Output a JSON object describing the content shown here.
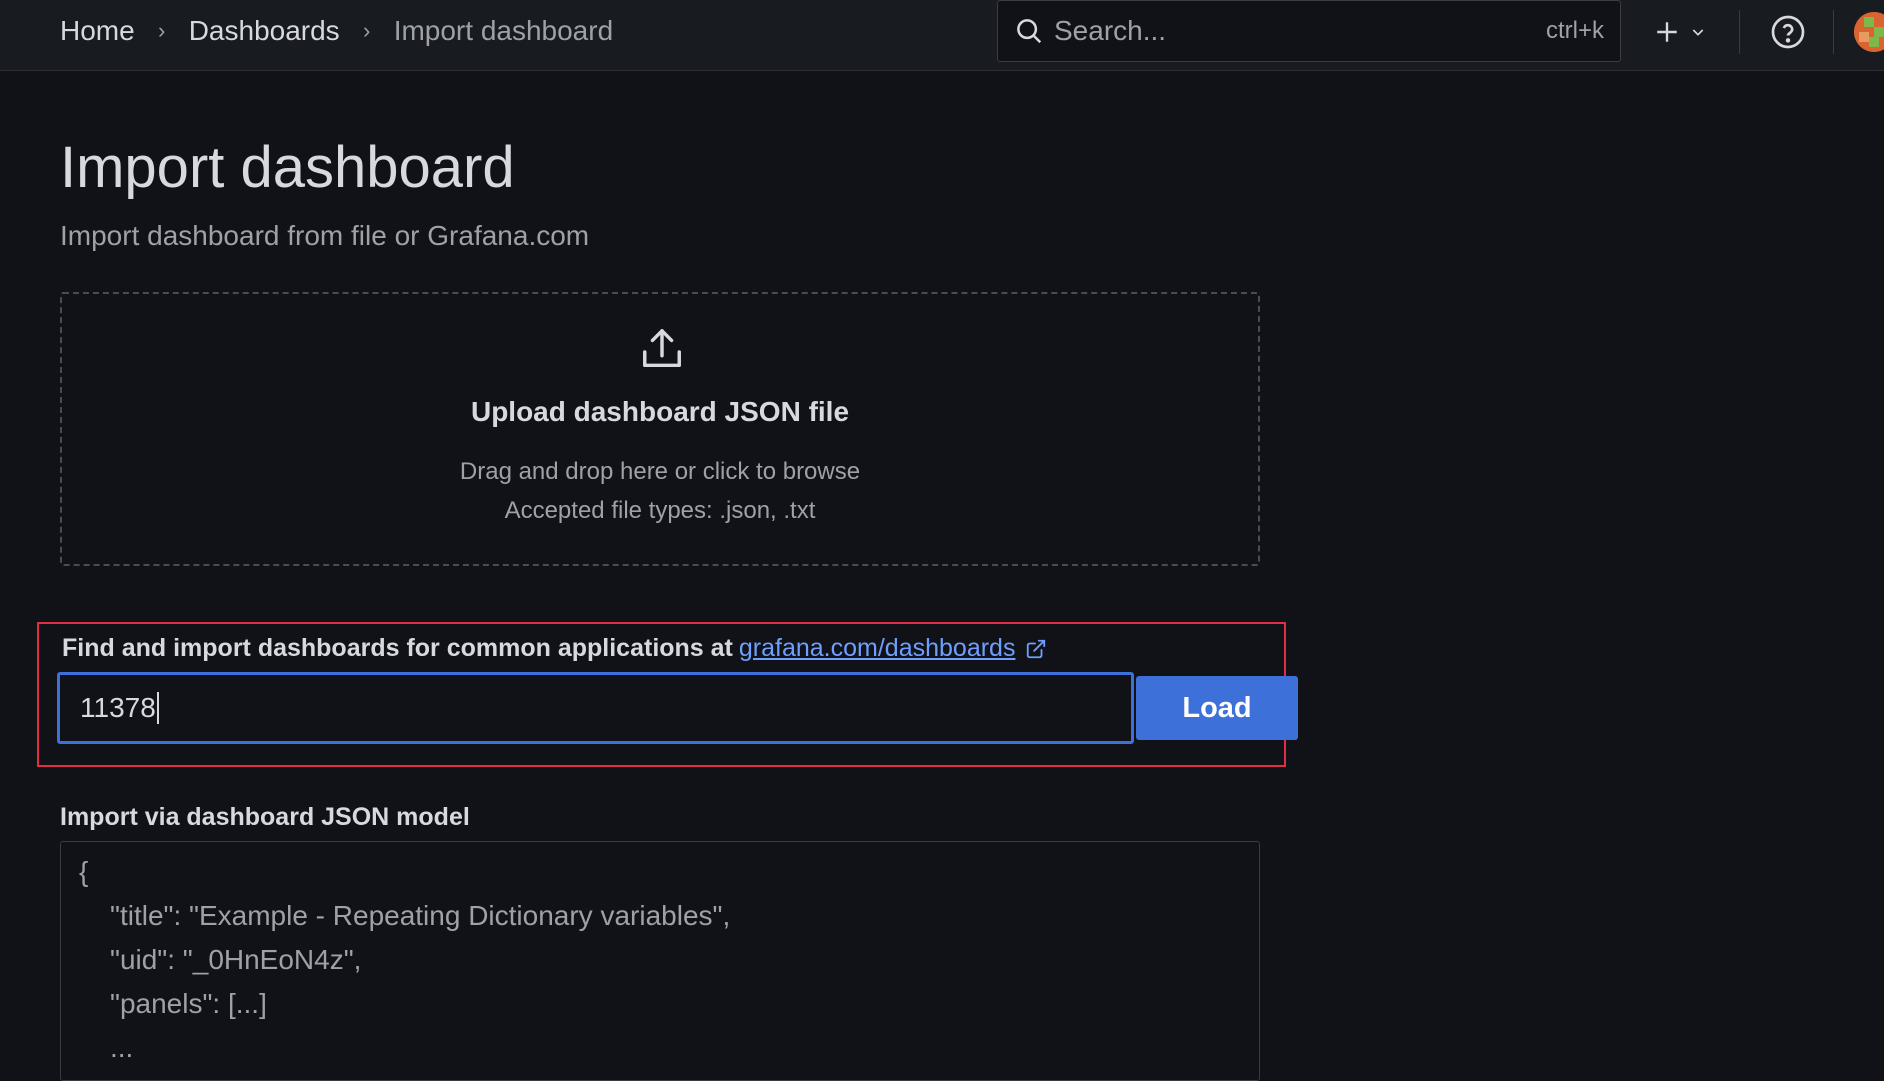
{
  "breadcrumb": {
    "items": [
      "Home",
      "Dashboards",
      "Import dashboard"
    ]
  },
  "search": {
    "placeholder": "Search...",
    "shortcut": "ctrl+k"
  },
  "page": {
    "title": "Import dashboard",
    "subtitle": "Import dashboard from file or Grafana.com"
  },
  "upload": {
    "title": "Upload dashboard JSON file",
    "hint": "Drag and drop here or click to browse",
    "types": "Accepted file types: .json, .txt"
  },
  "grafana_com": {
    "label": "Find and import dashboards for common applications at",
    "link_text": "grafana.com/dashboards",
    "input_value": "11378",
    "load_label": "Load"
  },
  "json_model": {
    "label": "Import via dashboard JSON model",
    "lines": [
      "{",
      "\"title\": \"Example - Repeating Dictionary variables\",",
      "\"uid\": \"_0HnEoN4z\",",
      "\"panels\": [...]",
      "..."
    ]
  },
  "colors": {
    "accent": "#3d71d9",
    "highlight_border": "#e02f44",
    "link": "#6e9fff"
  }
}
